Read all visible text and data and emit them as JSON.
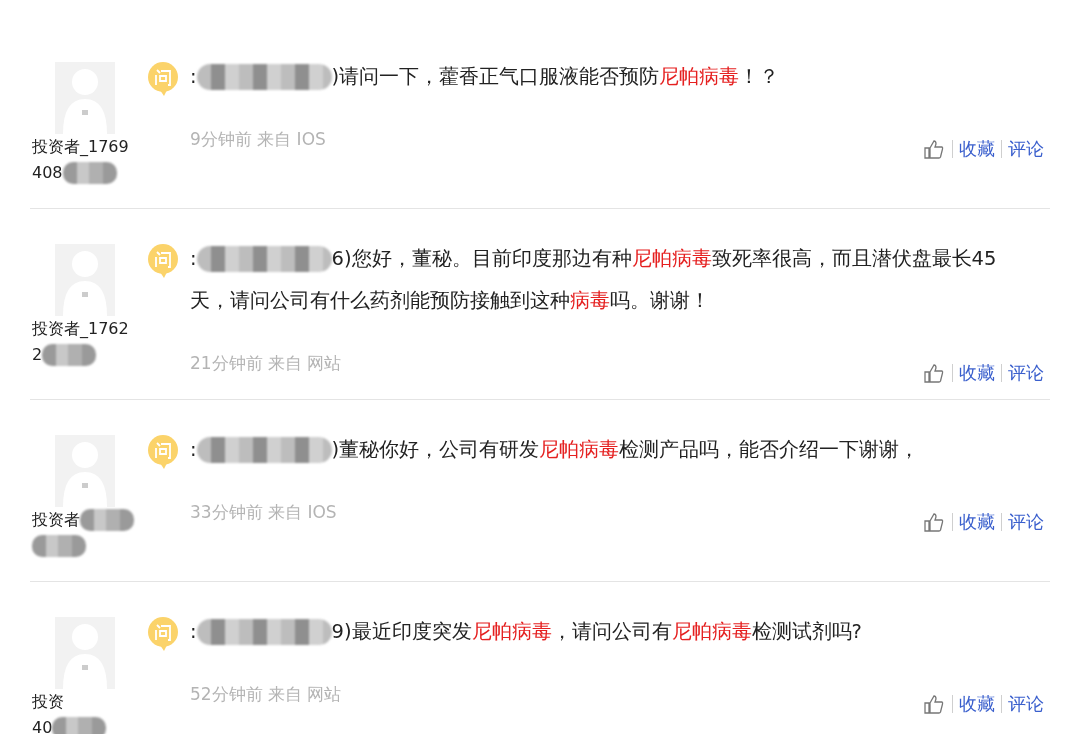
{
  "posts": [
    {
      "user_line1": "投资者_1769",
      "user_line2": "408",
      "prefix": ":",
      "question": [
        [
          {
            "text": ")请问一下，藿香正气口服液能否预防",
            "highlight": false
          },
          {
            "text": "尼帕病毒",
            "highlight": true
          },
          {
            "text": "！？",
            "highlight": false
          }
        ]
      ],
      "meta": "9分钟前 来自 IOS",
      "actions": [
        "收藏",
        "评论"
      ]
    },
    {
      "user_line1": "投资者_1762",
      "user_line2": "2",
      "prefix": ":",
      "question": [
        [
          {
            "text": "6)您好，董秘。目前印度那边有种",
            "highlight": false
          },
          {
            "text": "尼帕病毒",
            "highlight": true
          },
          {
            "text": "致死率很高，而且潜伏盘最长45",
            "highlight": false
          }
        ],
        [
          {
            "text": "天，请问公司有什么药剂能预防接触到这种",
            "highlight": false
          },
          {
            "text": "病毒",
            "highlight": true
          },
          {
            "text": "吗。谢谢！",
            "highlight": false
          }
        ]
      ],
      "meta": "21分钟前 来自 网站",
      "actions": [
        "收藏",
        "评论"
      ]
    },
    {
      "user_line1": "投资者",
      "prefix": ":",
      "question": [
        [
          {
            "text": ")董秘你好，公司有研发",
            "highlight": false
          },
          {
            "text": "尼帕病毒",
            "highlight": true
          },
          {
            "text": "检测产品吗，能否介绍一下谢谢，",
            "highlight": false
          }
        ]
      ],
      "meta": "33分钟前 来自 IOS",
      "actions": [
        "收藏",
        "评论"
      ]
    },
    {
      "user_line1": "投资",
      "user_line2": "40",
      "prefix": ":",
      "question": [
        [
          {
            "text": "9)最近印度突发",
            "highlight": false
          },
          {
            "text": "尼帕病毒",
            "highlight": true
          },
          {
            "text": "，请问公司有",
            "highlight": false
          },
          {
            "text": "尼帕病毒",
            "highlight": true
          },
          {
            "text": "检测试剂吗?",
            "highlight": false
          }
        ]
      ],
      "meta": "52分钟前 来自 网站",
      "actions": [
        "收藏",
        "评论"
      ]
    }
  ]
}
